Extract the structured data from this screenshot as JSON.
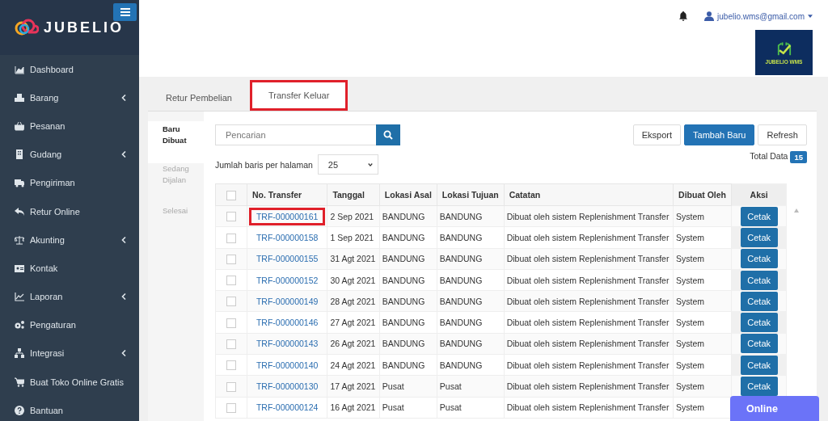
{
  "sidebar": {
    "brand": "JUBELIO",
    "items": [
      {
        "label": "Dashboard",
        "has_submenu": false
      },
      {
        "label": "Barang",
        "has_submenu": true
      },
      {
        "label": "Pesanan",
        "has_submenu": false
      },
      {
        "label": "Gudang",
        "has_submenu": true
      },
      {
        "label": "Pengiriman",
        "has_submenu": false
      },
      {
        "label": "Retur Online",
        "has_submenu": false
      },
      {
        "label": "Akunting",
        "has_submenu": true
      },
      {
        "label": "Kontak",
        "has_submenu": false
      },
      {
        "label": "Laporan",
        "has_submenu": true
      },
      {
        "label": "Pengaturan",
        "has_submenu": false
      },
      {
        "label": "Integrasi",
        "has_submenu": true
      },
      {
        "label": "Buat Toko Online Gratis",
        "has_submenu": false
      },
      {
        "label": "Bantuan",
        "has_submenu": false
      }
    ]
  },
  "header": {
    "user": "jubelio.wms@gmail.com",
    "badge_text": "JUBELIO WMS"
  },
  "tabs": [
    {
      "label": "Retur Pembelian",
      "selected": false,
      "highlighted": false
    },
    {
      "label": "Transfer Keluar",
      "selected": true,
      "highlighted": true
    }
  ],
  "subtabs": [
    {
      "label": "Baru Dibuat",
      "selected": true
    },
    {
      "label": "Sedang Dijalan",
      "selected": false
    },
    {
      "label": "Selesai",
      "selected": false
    }
  ],
  "search": {
    "placeholder": "Pencarian"
  },
  "buttons": [
    {
      "label": "Eksport",
      "kind": "default"
    },
    {
      "label": "Tambah Baru",
      "kind": "primary"
    },
    {
      "label": "Refresh",
      "kind": "default"
    }
  ],
  "page_size": {
    "label": "Jumlah baris per halaman",
    "value": "25"
  },
  "total": {
    "label": "Total Data",
    "value": "15"
  },
  "table": {
    "select_all": {
      "checked": false
    },
    "columns": [
      "No. Transfer",
      "Tanggal",
      "Lokasi Asal",
      "Lokasi Tujuan",
      "Catatan",
      "Dibuat Oleh",
      "Aksi"
    ],
    "rows": [
      {
        "checked": false,
        "number": "TRF-000000161",
        "highlighted": true,
        "date": "2 Sep 2021",
        "from": "BANDUNG",
        "to": "BANDUNG",
        "note": "Dibuat oleh sistem Replenishment Transfer",
        "by": "System",
        "action": "Cetak"
      },
      {
        "checked": false,
        "number": "TRF-000000158",
        "highlighted": false,
        "date": "1 Sep 2021",
        "from": "BANDUNG",
        "to": "BANDUNG",
        "note": "Dibuat oleh sistem Replenishment Transfer",
        "by": "System",
        "action": "Cetak"
      },
      {
        "checked": false,
        "number": "TRF-000000155",
        "highlighted": false,
        "date": "31 Agt 2021",
        "from": "BANDUNG",
        "to": "BANDUNG",
        "note": "Dibuat oleh sistem Replenishment Transfer",
        "by": "System",
        "action": "Cetak"
      },
      {
        "checked": false,
        "number": "TRF-000000152",
        "highlighted": false,
        "date": "30 Agt 2021",
        "from": "BANDUNG",
        "to": "BANDUNG",
        "note": "Dibuat oleh sistem Replenishment Transfer",
        "by": "System",
        "action": "Cetak"
      },
      {
        "checked": false,
        "number": "TRF-000000149",
        "highlighted": false,
        "date": "28 Agt 2021",
        "from": "BANDUNG",
        "to": "BANDUNG",
        "note": "Dibuat oleh sistem Replenishment Transfer",
        "by": "System",
        "action": "Cetak"
      },
      {
        "checked": false,
        "number": "TRF-000000146",
        "highlighted": false,
        "date": "27 Agt 2021",
        "from": "BANDUNG",
        "to": "BANDUNG",
        "note": "Dibuat oleh sistem Replenishment Transfer",
        "by": "System",
        "action": "Cetak"
      },
      {
        "checked": false,
        "number": "TRF-000000143",
        "highlighted": false,
        "date": "26 Agt 2021",
        "from": "BANDUNG",
        "to": "BANDUNG",
        "note": "Dibuat oleh sistem Replenishment Transfer",
        "by": "System",
        "action": "Cetak"
      },
      {
        "checked": false,
        "number": "TRF-000000140",
        "highlighted": false,
        "date": "24 Agt 2021",
        "from": "BANDUNG",
        "to": "BANDUNG",
        "note": "Dibuat oleh sistem Replenishment Transfer",
        "by": "System",
        "action": "Cetak"
      },
      {
        "checked": false,
        "number": "TRF-000000130",
        "highlighted": false,
        "date": "17 Agt 2021",
        "from": "Pusat",
        "to": "Pusat",
        "note": "Dibuat oleh sistem Replenishment Transfer",
        "by": "System",
        "action": "Cetak"
      },
      {
        "checked": false,
        "number": "TRF-000000124",
        "highlighted": false,
        "date": "16 Agt 2021",
        "from": "Pusat",
        "to": "Pusat",
        "note": "Dibuat oleh sistem Replenishment Transfer",
        "by": "System"
      }
    ]
  },
  "chat": {
    "label": "Online"
  }
}
